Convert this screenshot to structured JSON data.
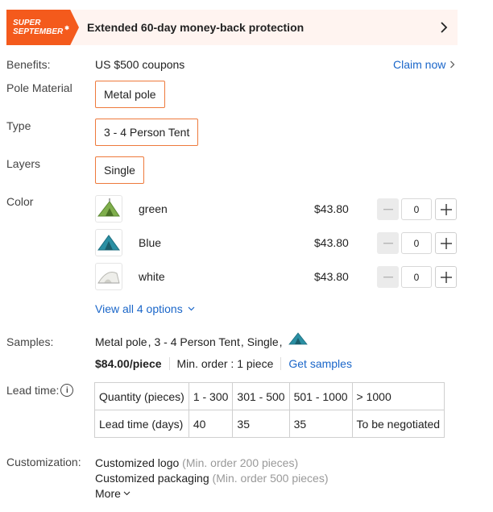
{
  "promo": {
    "badge_line1": "SUPER",
    "badge_line2": "SEPTEMBER",
    "badge_star": "✱",
    "text": "Extended 60-day money-back protection"
  },
  "benefits": {
    "label": "Benefits:",
    "value": "US $500 coupons",
    "claim": "Claim now"
  },
  "pole_material": {
    "label": "Pole Material",
    "option": "Metal pole"
  },
  "type": {
    "label": "Type",
    "option": "3 - 4 Person Tent"
  },
  "layers": {
    "label": "Layers",
    "option": "Single"
  },
  "color": {
    "label": "Color",
    "items": [
      {
        "name": "green",
        "price": "$43.80",
        "qty": "0",
        "tent_color": "#7fae4c"
      },
      {
        "name": "Blue",
        "price": "$43.80",
        "qty": "0",
        "tent_color": "#2a8fa3"
      },
      {
        "name": "white",
        "price": "$43.80",
        "qty": "0",
        "tent_color": "#e7e7e2"
      }
    ],
    "view_all": "View all 4 options"
  },
  "samples": {
    "label": "Samples:",
    "part1": "Metal pole",
    "part2": "3 - 4 Person Tent",
    "part3": "Single",
    "sep": ",",
    "price": "$84.00/piece",
    "min_order": "Min. order : 1 piece",
    "get_samples": "Get samples"
  },
  "lead_time": {
    "label": "Lead time:",
    "info": "i",
    "rows": [
      [
        "Quantity (pieces)",
        "1 - 300",
        "301 - 500",
        "501 - 1000",
        "> 1000"
      ],
      [
        "Lead time (days)",
        "40",
        "35",
        "35",
        "To be negotiated"
      ]
    ]
  },
  "customization": {
    "label": "Customization:",
    "items": [
      {
        "name": "Customized logo",
        "note": "(Min. order 200 pieces)"
      },
      {
        "name": "Customized packaging",
        "note": "(Min. order 500 pieces)"
      }
    ],
    "more": "More"
  },
  "colors": {
    "accent": "#f45a1c",
    "link": "#1a66c9",
    "option_border": "#ee7a3c"
  }
}
